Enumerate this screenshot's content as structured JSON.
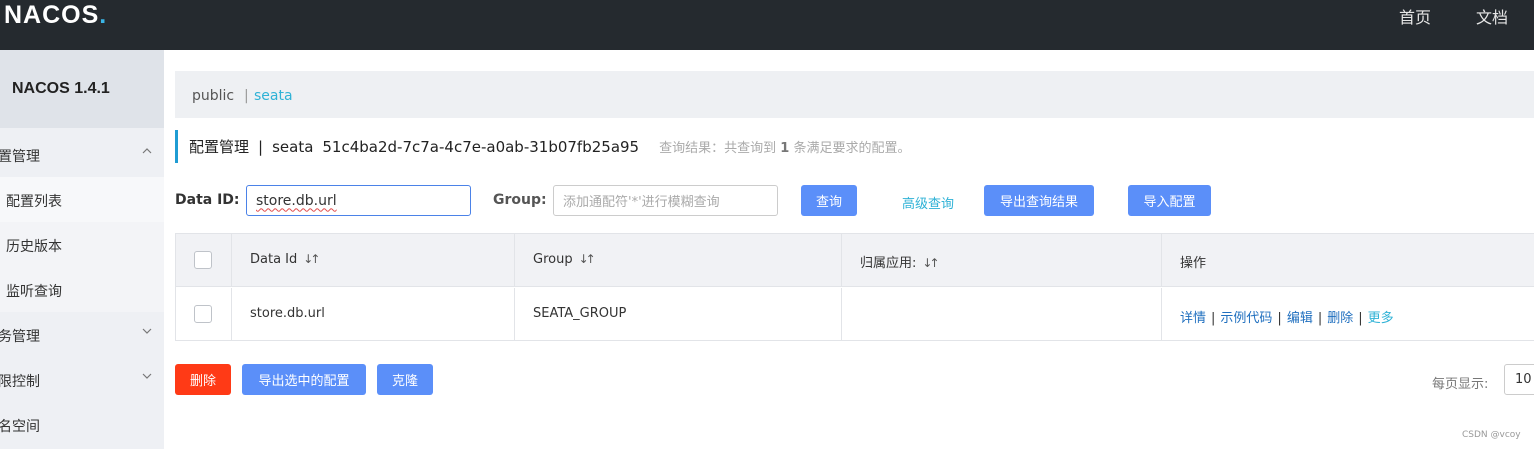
{
  "header": {
    "logo_text": "NACOS",
    "nav": [
      "首页",
      "文档"
    ]
  },
  "sidebar": {
    "brand": "NACOS 1.4.1",
    "items": [
      {
        "label": "置管理",
        "expanded": true
      },
      {
        "label": "配置列表",
        "sub": true
      },
      {
        "label": "历史版本",
        "sub": true
      },
      {
        "label": "监听查询",
        "sub": true
      },
      {
        "label": "务管理",
        "expanded": false
      },
      {
        "label": "限控制",
        "expanded": false
      },
      {
        "label": "名空间"
      }
    ]
  },
  "namespace": {
    "public": "public",
    "separator": "|",
    "current": "seata"
  },
  "title": {
    "section": "配置管理",
    "separator": "|",
    "namespace": "seata",
    "namespace_id": "51c4ba2d-7c7a-4c7e-a0ab-31b07fb25a95",
    "result_prefix": "查询结果：共查询到",
    "result_count": "1",
    "result_suffix": "条满足要求的配置。"
  },
  "search": {
    "data_id_label": "Data ID:",
    "data_id_value": "store.db.url",
    "group_label": "Group:",
    "group_placeholder": "添加通配符'*'进行模糊查询",
    "query_button": "查询",
    "advanced_link": "高级查询",
    "export_results_button": "导出查询结果",
    "import_button": "导入配置"
  },
  "table": {
    "columns": [
      "Data Id",
      "Group",
      "归属应用:",
      "操作"
    ],
    "sort_glyph": "↓↑",
    "rows": [
      {
        "data_id": "store.db.url",
        "group": "SEATA_GROUP",
        "app": ""
      }
    ],
    "actions": [
      "详情",
      "示例代码",
      "编辑",
      "删除",
      "更多"
    ]
  },
  "footer": {
    "delete_button": "删除",
    "export_selected_button": "导出选中的配置",
    "clone_button": "克隆",
    "page_size_label": "每页显示:",
    "page_size_value": "10"
  },
  "watermark": "CSDN @vcoy",
  "colors": {
    "header_bg": "#252a2f",
    "primary_button": "#5b8ff9",
    "danger_button": "#ff3a16",
    "link": "#1f6fbf",
    "accent_link": "#2fb2d6"
  }
}
